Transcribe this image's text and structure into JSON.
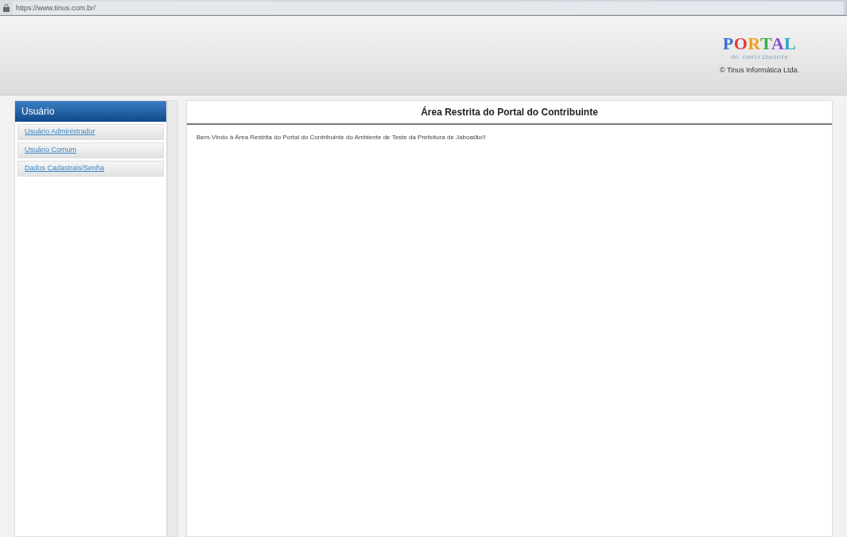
{
  "address_bar": {
    "url": "https://www.tinus.com.br/"
  },
  "header": {
    "logo": "PORTAL",
    "logo_subtitle": "do contribuinte",
    "copyright": "© Tinus Informática Ltda."
  },
  "sidebar": {
    "title": "Usuário",
    "items": [
      {
        "label": "Usuário Administrador"
      },
      {
        "label": "Usuário Comum"
      },
      {
        "label": "Dados Cadastrais/Senha"
      }
    ]
  },
  "main": {
    "title": "Área Restrita do Portal do Contribuinte",
    "message": "Bem-Vindo à Área Restrita do Portal do Contribuinte do Ambiente de Teste da Prefeitura de Jaboatão!!"
  }
}
